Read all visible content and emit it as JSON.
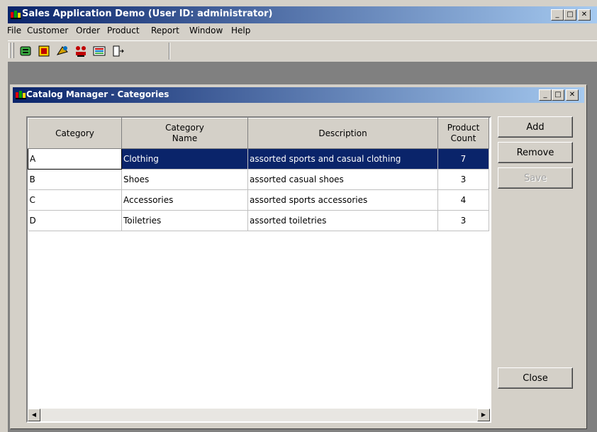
{
  "app": {
    "title": "Sales Application Demo (User ID: administrator)",
    "min": "_",
    "max": "□",
    "close": "✕"
  },
  "menu": {
    "items": [
      {
        "label": "File"
      },
      {
        "label": "Customer"
      },
      {
        "label": "Order"
      },
      {
        "label": "Product"
      },
      {
        "label": "Report"
      },
      {
        "label": "Window"
      },
      {
        "label": "Help"
      }
    ]
  },
  "toolbar": {
    "icons": [
      "customers-icon",
      "orders-icon",
      "products-icon",
      "categories-icon",
      "reports-icon",
      "exit-icon"
    ]
  },
  "child": {
    "title": "Catalog Manager - Categories",
    "min": "_",
    "max": "□",
    "close": "✕"
  },
  "grid": {
    "headers": {
      "category": "Category",
      "name_line1": "Category",
      "name_line2": "Name",
      "description": "Description",
      "count_line1": "Product",
      "count_line2": "Count"
    },
    "rows": [
      {
        "category": "A",
        "name": "Clothing",
        "description": "assorted sports and casual clothing",
        "count": "7"
      },
      {
        "category": "B",
        "name": "Shoes",
        "description": "assorted casual shoes",
        "count": "3"
      },
      {
        "category": "C",
        "name": "Accessories",
        "description": "assorted sports accessories",
        "count": "4"
      },
      {
        "category": "D",
        "name": "Toiletries",
        "description": "assorted toiletries",
        "count": "3"
      }
    ],
    "selected_row": 0,
    "scroll_left": "◀",
    "scroll_right": "▶"
  },
  "buttons": {
    "add": "Add",
    "remove": "Remove",
    "save": "Save",
    "close": "Close"
  },
  "colors": {
    "titlebar": "#0a246a",
    "selection": "#0a246a",
    "face": "#d4d0c8"
  }
}
